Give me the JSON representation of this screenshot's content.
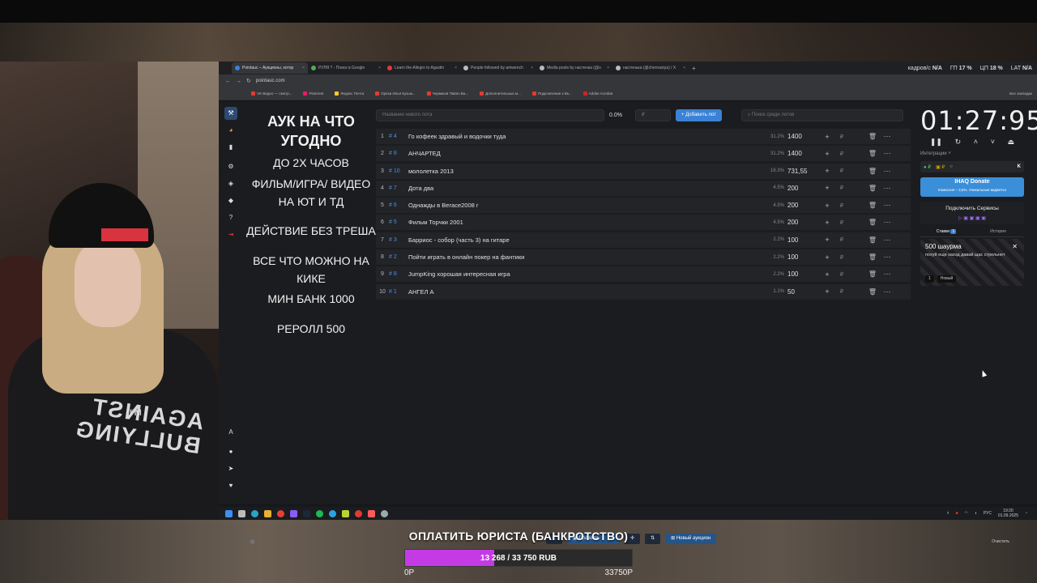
{
  "browser": {
    "tabs": [
      {
        "label": "Pointauc – Аукционы, котор",
        "active": true,
        "color": "#3a82d6"
      },
      {
        "label": "РУЛЯ ? - Поиск в Google",
        "active": false,
        "color": "#4caf50"
      },
      {
        "label": "Learn the Allegro to Agustin",
        "active": false,
        "color": "#e53935"
      },
      {
        "label": "People followed by amwench",
        "active": false,
        "color": "#bbbbbb"
      },
      {
        "label": "Media posts by настенка (@н",
        "active": false,
        "color": "#bbbbbb"
      },
      {
        "label": "настенька (@chernastya) / X",
        "active": false,
        "color": "#bbbbbb"
      }
    ],
    "sysinfo": {
      "fps_label": "кадров/с",
      "fps_value": "N/A",
      "gpu_label": "ГП",
      "gpu_value": "17 %",
      "cpu_label": "ЦП",
      "cpu_value": "18 %",
      "lat_label": "LAT",
      "lat_value": "N/A"
    },
    "url": "pointauc.com",
    "bookmarks": [
      "VK Видео — смотр...",
      "Pinterest",
      "Яндекс Почта",
      "Орехи Илья Кузьм...",
      "Черваков Павел Ва...",
      "Дополнительные м...",
      "Подключение к Вк...",
      "Adobe Acrobat"
    ],
    "bookmarks_right": "Все закладки"
  },
  "rules": {
    "title": "АУК НА ЧТО УГОДНО",
    "lines": [
      "ДО 2Х ЧАСОВ",
      "ФИЛЬМ/ИГРА/ ВИДЕО НА ЮТ И ТД",
      "ДЕЙСТВИЕ БЕЗ ТРЕША",
      "ВСЕ ЧТО МОЖНО НА КИКЕ",
      "МИН БАНК 1000",
      "РЕРОЛЛ 500"
    ]
  },
  "toolbar": {
    "lot_placeholder": "Название нового лота",
    "percent": "0.0%",
    "amount_placeholder": "₽",
    "add_button": "Добавить лот",
    "search_placeholder": "Поиск среди лотов"
  },
  "lots": [
    {
      "n": "1",
      "id": "# 4",
      "name": "Го кофеек здравый и водочки туда",
      "percent": "31.2%",
      "amount": "1400"
    },
    {
      "n": "2",
      "id": "# 8",
      "name": "АНЧАРТЕД",
      "percent": "31.2%",
      "amount": "1400"
    },
    {
      "n": "3",
      "id": "# 10",
      "name": "мололетка 2013",
      "percent": "16.3%",
      "amount": "731,55"
    },
    {
      "n": "4",
      "id": "# 7",
      "name": "Дота два",
      "percent": "4.5%",
      "amount": "200"
    },
    {
      "n": "5",
      "id": "# 6",
      "name": "Однажды в Вегасе2008 г",
      "percent": "4.5%",
      "amount": "200"
    },
    {
      "n": "6",
      "id": "# 5",
      "name": "Фильм Торчки 2001",
      "percent": "4.5%",
      "amount": "200"
    },
    {
      "n": "7",
      "id": "# 3",
      "name": "Барриос - собор (часть 3) на гитаре",
      "percent": "2.2%",
      "amount": "100"
    },
    {
      "n": "8",
      "id": "# 2",
      "name": "Пойти играть в онлайн покер на фантики",
      "percent": "2.2%",
      "amount": "100"
    },
    {
      "n": "9",
      "id": "# 8",
      "name": "JumpKing хорошая интересная игра",
      "percent": "2.2%",
      "amount": "100"
    },
    {
      "n": "10",
      "id": "# 1",
      "name": "АНГЕЛ А",
      "percent": "1.1%",
      "amount": "50"
    }
  ],
  "timer": {
    "value": "01:27:95",
    "integrations_label": "Интеграции"
  },
  "donate": {
    "title": "IHAQ Donate",
    "subtitle": "Комиссия – 3,5%. Уникальные виджеты!"
  },
  "connect": {
    "label": "Подключить Сервисы"
  },
  "bets": {
    "tab_bets": "Ставки",
    "tab_bets_count": "1",
    "tab_history": "История",
    "card": {
      "amount": "500 шаурма",
      "message": "похуй еще заход давай щас стрельнет",
      "index": "1",
      "action": "Новый"
    }
  },
  "bottom": {
    "rules_button": "Правила",
    "percent_button": "%",
    "new_auction_button": "Новый аукцион",
    "clear_label": "Очистить"
  },
  "taskbar": {
    "lang": "РУС",
    "time": "19:20",
    "date": "01.09.2025"
  },
  "goal": {
    "title": "ОПЛАТИТЬ ЮРИСТА (БАНКРОТСТВО)",
    "progress_text": "13 268 / 33 750 RUB",
    "current": 13268,
    "target": 33750,
    "start_label": "0Р",
    "end_label": "33750Р",
    "bar_color": "#c43be6"
  },
  "shirt": {
    "small": "I'M",
    "big": "AGAINST BULLYING"
  }
}
